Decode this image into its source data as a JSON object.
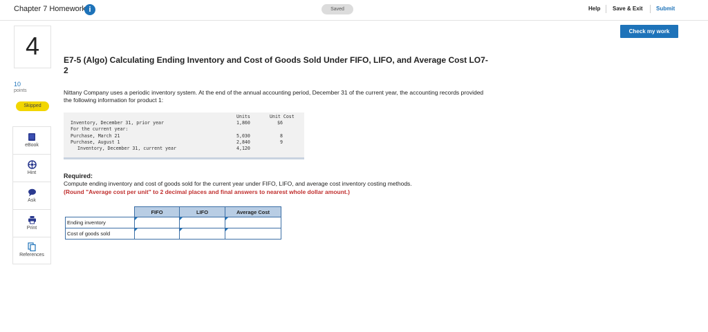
{
  "header": {
    "title": "Chapter 7 Homework",
    "info_icon": "i",
    "saved": "Saved",
    "help": "Help",
    "save_exit": "Save & Exit",
    "submit": "Submit",
    "check_work": "Check my work"
  },
  "question": {
    "number": "4",
    "points_value": "10",
    "points_label": "points",
    "status": "Skipped",
    "title": "E7-5 (Algo) Calculating Ending Inventory and Cost of Goods Sold Under FIFO, LIFO, and Average Cost LO7-2",
    "intro": "Nittany Company uses a periodic inventory system. At the end of the annual accounting period, December 31 of the current year, the accounting records provided the following information for product 1:"
  },
  "tools": [
    {
      "label": "eBook",
      "icon": "book-icon"
    },
    {
      "label": "Hint",
      "icon": "hint-icon"
    },
    {
      "label": "Ask",
      "icon": "chat-icon"
    },
    {
      "label": "Print",
      "icon": "print-icon"
    },
    {
      "label": "References",
      "icon": "references-icon"
    }
  ],
  "inventory": {
    "col_units": "Units",
    "col_cost": "Unit Cost",
    "rows": [
      {
        "label": "Inventory, December 31, prior year",
        "units": "1,860",
        "cost": "$6"
      },
      {
        "label": "For the current year:",
        "units": "",
        "cost": ""
      },
      {
        "label": "Purchase, March 21",
        "units": "5,030",
        "cost": "8"
      },
      {
        "label": "Purchase, August 1",
        "units": "2,840",
        "cost": "9"
      },
      {
        "label": "Inventory, December 31, current year",
        "units": "4,120",
        "cost": ""
      }
    ]
  },
  "required": {
    "heading": "Required:",
    "body": "Compute ending inventory and cost of goods sold for the current year under FIFO, LIFO, and average cost inventory costing methods.",
    "note": "(Round \"Average cost per unit\" to 2 decimal places and final answers to nearest whole dollar amount.)"
  },
  "answer_table": {
    "columns": [
      "FIFO",
      "LIFO",
      "Average Cost"
    ],
    "rows": [
      {
        "label": "Ending inventory",
        "values": [
          "",
          "",
          ""
        ]
      },
      {
        "label": "Cost of goods sold",
        "values": [
          "",
          "",
          ""
        ]
      }
    ]
  },
  "colors": {
    "accent": "#1e73b9",
    "skipped": "#f2d600",
    "note_red": "#c0302f",
    "table_header": "#b8cde4"
  }
}
